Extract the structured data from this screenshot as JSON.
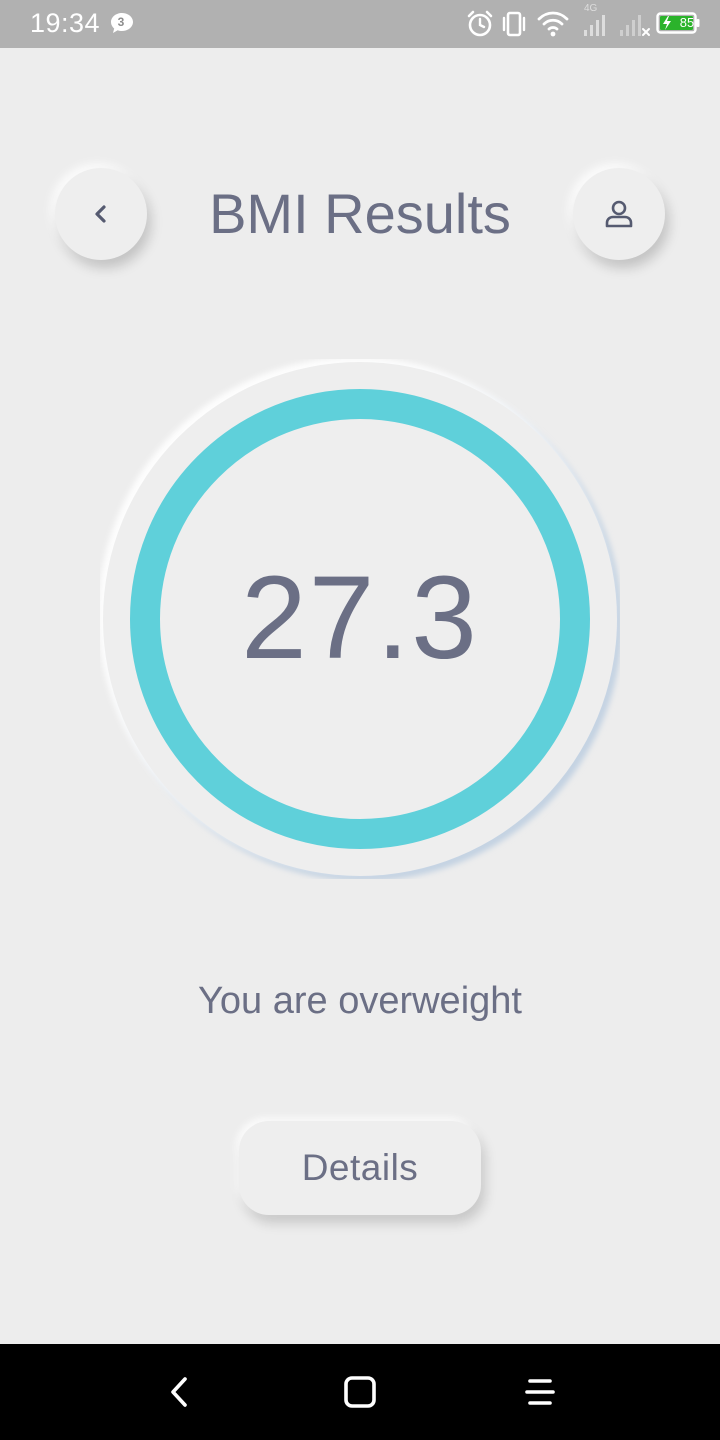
{
  "status_bar": {
    "time": "19:34",
    "notification_count": "3",
    "battery_level": "85",
    "network_label": "4G",
    "icons": [
      "message-icon",
      "alarm-icon",
      "vibrate-icon",
      "wifi-icon",
      "signal-icon",
      "signal-no-service-icon",
      "battery-charging-icon"
    ],
    "battery_color": "#2bb32b"
  },
  "header": {
    "title": "BMI Results",
    "back_icon": "chevron-left-icon",
    "profile_icon": "user-icon"
  },
  "result": {
    "bmi_value": "27.3",
    "status": "You are overweight",
    "ring_color": "#5fd0da"
  },
  "actions": {
    "details_label": "Details"
  },
  "nav_bar": {
    "icons": [
      "nav-back-icon",
      "nav-home-icon",
      "nav-menu-icon"
    ]
  },
  "colors": {
    "background": "#ededed",
    "text": "#6b6f85",
    "accent": "#5fd0da"
  }
}
